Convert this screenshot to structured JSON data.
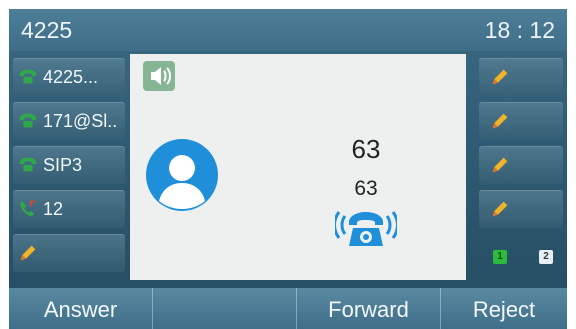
{
  "status": {
    "account": "4225",
    "time": "18 : 12"
  },
  "line_keys_left": [
    {
      "label": "4225...",
      "icon": "phone-icon"
    },
    {
      "label": "171@Sl..",
      "icon": "phone-icon"
    },
    {
      "label": "SIP3",
      "icon": "phone-icon"
    },
    {
      "label": "12",
      "icon": "incoming-call-icon"
    },
    {
      "label": "",
      "icon": "pencil-icon"
    }
  ],
  "line_keys_right": [
    {
      "label": "",
      "icon": "pencil-icon"
    },
    {
      "label": "",
      "icon": "pencil-icon"
    },
    {
      "label": "",
      "icon": "pencil-icon"
    },
    {
      "label": "",
      "icon": "pencil-icon"
    }
  ],
  "call": {
    "name": "63",
    "number": "63",
    "state_icon": "ringing-phone-icon",
    "audio_icon": "speaker-icon"
  },
  "pages": {
    "page1": "1",
    "page2": "2"
  },
  "softkeys": {
    "answer": "Answer",
    "blank": "",
    "forward": "Forward",
    "reject": "Reject"
  },
  "colors": {
    "background": "#2f5c74",
    "panel": "#eef0ef",
    "accent": "#1f8fd6",
    "phone_green": "#2fa84a"
  }
}
